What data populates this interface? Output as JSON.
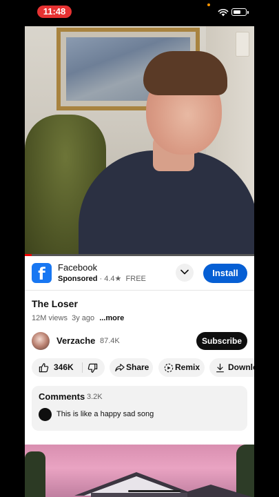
{
  "status_bar": {
    "time": "11:48"
  },
  "ad": {
    "advertiser": "Facebook",
    "logo_letter": "f",
    "sponsored_label": "Sponsored",
    "rating": "4.4",
    "star": "★",
    "separator": "·",
    "price": "FREE",
    "install_label": "Install"
  },
  "video": {
    "title": "The Loser",
    "views": "12M views",
    "age": "3y ago",
    "more_label": "...more"
  },
  "channel": {
    "name": "Verzache",
    "subscribers": "87.4K",
    "subscribe_label": "Subscribe"
  },
  "actions": {
    "likes": "346K",
    "share_label": "Share",
    "remix_label": "Remix",
    "download_label": "Downlo"
  },
  "comments": {
    "title": "Comments",
    "count": "3.2K",
    "top_comment": "This is like a happy sad song"
  },
  "colors": {
    "accent_blue": "#065fd4",
    "facebook_blue": "#1877f2",
    "status_red": "#e63232"
  }
}
